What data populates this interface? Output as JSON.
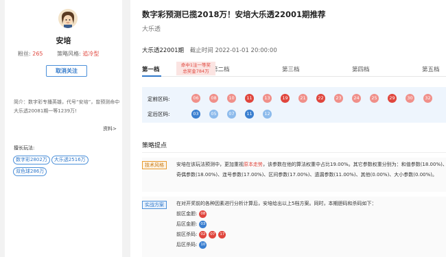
{
  "profile": {
    "name": "安培",
    "fans_label": "粉丝:",
    "fans": "265",
    "style_label": "策略风格:",
    "style": "追冷型",
    "follow_button": "取消关注",
    "intro": "简介：数字彩专播英雄，代号“安培”，曾预测命中大乐透20081期一等1239万!",
    "more": "资料>",
    "skills_title": "擅长玩法:",
    "skills": [
      "数字彩2802万",
      "大乐透2516万",
      "双色球286万"
    ]
  },
  "article": {
    "title": "数字彩预测已揽2018万！安培大乐透22001期推荐",
    "subtitle": "大乐透",
    "issue": "大乐透22001期",
    "deadline": "截止时间 2022-01-01 20:00:00",
    "tabs": [
      "第一档",
      "第二档",
      "第三档",
      "第四档",
      "第五档"
    ],
    "tip_line1": "命中1注一等奖",
    "tip_line2": "总奖金784万",
    "front_label": "定前区码:",
    "back_label": "定后区码:",
    "front_balls": [
      "06",
      "08",
      "10",
      "11",
      "13",
      "19",
      "21",
      "22",
      "23",
      "24",
      "25",
      "29",
      "30",
      "32"
    ],
    "back_balls": [
      "03",
      "05",
      "07",
      "11",
      "12"
    ],
    "strategy_title": "策略提点",
    "tech_label": "技术风格",
    "tech_text_1": "安培在该玩法预测中，更加重视",
    "tech_highlight": "原本走势",
    "tech_text_2": "，该参数在他的算法权重中占比19.00%。其它参数权重分别为：和值参数(18.00%)、奇偶参数(18.00%)、连号参数(17.00%)、区间参数(17.00%)、遗漏参数(11.00%)、其他(0.00%)、大小参数(0.00%)。",
    "plan_label": "实战方案",
    "plan_text": "在对开奖前的各种因素进行分析计算后，安培给出以上5档方案。同时，本期胆码和杀码如下：",
    "dan_front_label": "前区金胆:",
    "dan_front": [
      "08"
    ],
    "dan_back_label": "后区金胆:",
    "dan_back": [
      "03"
    ],
    "kill_front_label": "前区杀码:",
    "kill_front": [
      "02",
      "07",
      "17"
    ],
    "kill_back_label": "后区杀码:",
    "kill_back": [
      "10"
    ]
  },
  "colors": {
    "red": "#e0463d",
    "light_red": "#f0908a",
    "blue": "#3a7fd0",
    "light_blue": "#8dbbec"
  }
}
